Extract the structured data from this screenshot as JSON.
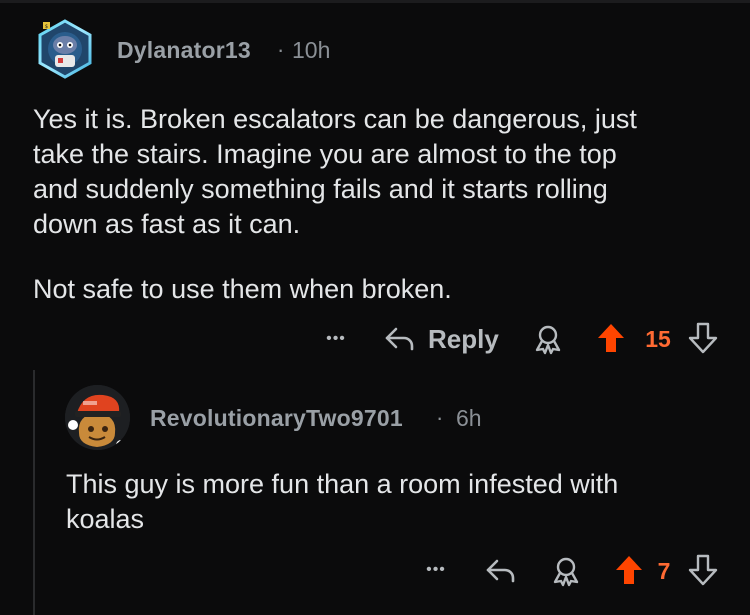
{
  "comment1": {
    "username": "Dylanator13",
    "time": "10h",
    "body_lines": [
      "Yes it is. Broken escalators can be dangerous, just",
      "take the stairs. Imagine you are almost to the top",
      "and suddenly something fails and it starts rolling",
      "down as fast as it can."
    ],
    "body_para2": "Not safe to use them when broken.",
    "reply_label": "Reply",
    "score": "15",
    "more_glyph": "•••"
  },
  "comment2": {
    "username": "RevolutionaryTwo9701",
    "time": "6h",
    "body_lines": [
      "This guy is more fun than a room infested with",
      "koalas"
    ],
    "score": "7",
    "more_glyph": "•••"
  },
  "separator": "·",
  "colors": {
    "background": "#0b0b0c",
    "upvote_active": "#ff4500",
    "score_text": "#ff6a33",
    "muted": "#8b9096"
  },
  "icons": {
    "more": "more-options-icon",
    "reply": "reply-arrow-icon",
    "award": "award-icon",
    "upvote": "upvote-arrow-icon",
    "downvote": "downvote-arrow-icon"
  }
}
